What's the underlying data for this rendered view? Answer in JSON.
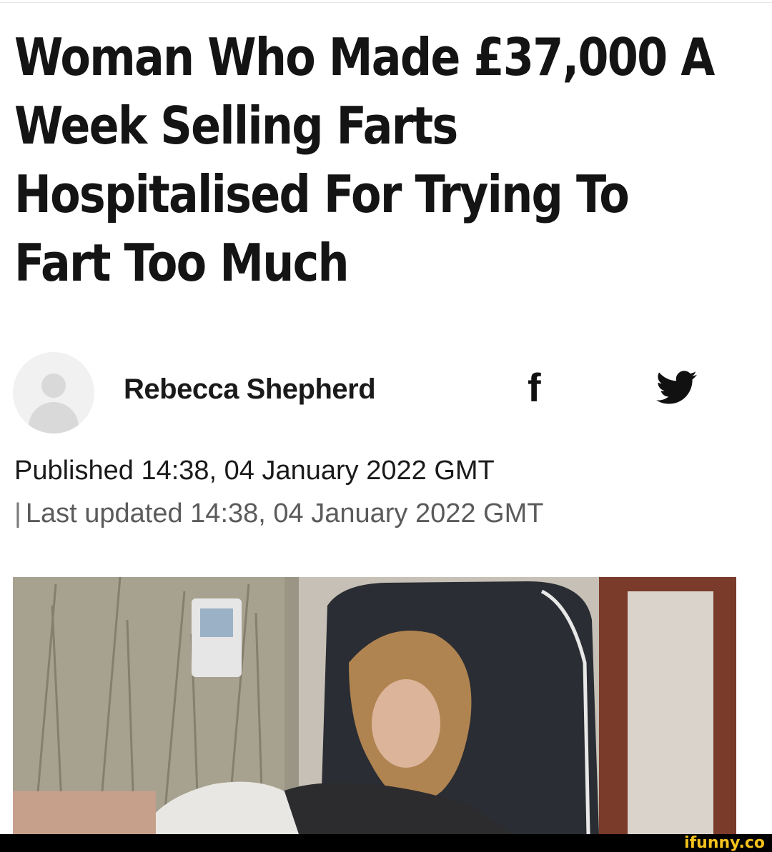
{
  "article": {
    "headline_lines": [
      "Woman Who Made £37,000 A",
      "Week Selling Farts",
      "Hospitalised For Trying To",
      "Fart Too Much"
    ],
    "author": "Rebecca Shepherd",
    "published": "Published 14:38, 04 January 2022 GMT",
    "updated_separator": "|",
    "updated": "Last updated 14:38, 04 January 2022 GMT"
  },
  "share": {
    "facebook_glyph": "f",
    "facebook_icon": "facebook-icon",
    "twitter_icon": "twitter-icon"
  },
  "watermark": {
    "text": "ifunny.co",
    "color": "#f4c21c"
  },
  "colors": {
    "text": "#141414",
    "muted": "#5b5b5b",
    "background": "#ffffff"
  }
}
